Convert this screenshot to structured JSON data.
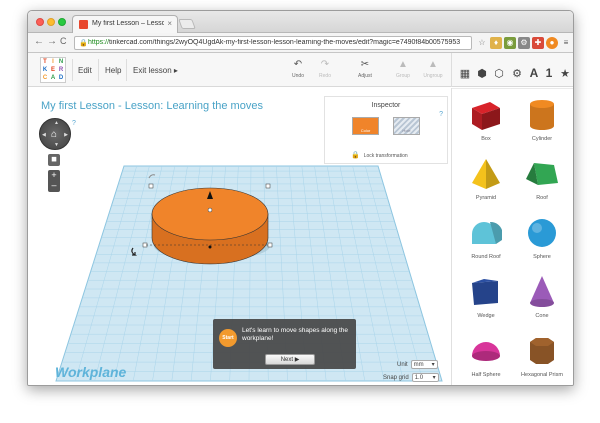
{
  "browser": {
    "tab_title": "My first Lesson – Lesson",
    "tab_close": "×",
    "url_scheme": "https://",
    "url_rest": "tinkercad.com/things/2wyOQ4UgdAk-my-first-lesson-lesson-learning-the-moves/edit?magic=e7490f84b00575953",
    "back": "←",
    "forward": "→",
    "reload": "C",
    "ext_icons": [
      "☆",
      "♦",
      "◉",
      "⚙",
      "✚",
      "●",
      "≡"
    ]
  },
  "logo": {
    "letters": [
      "T",
      "I",
      "N",
      "K",
      "E",
      "R",
      "C",
      "A",
      "D"
    ],
    "colors": [
      "#e2401c",
      "#f29a2e",
      "#2f9d4c",
      "#1d6fc5",
      "#e2401c",
      "#8d4fb1",
      "#f29a2e",
      "#2f9d4c",
      "#1d6fc5"
    ]
  },
  "menu": {
    "edit": "Edit",
    "help": "Help",
    "exit": "Exit lesson ▸"
  },
  "toolbar": {
    "undo": {
      "icon": "↶",
      "label": "Undo"
    },
    "redo": {
      "icon": "↷",
      "label": "Redo"
    },
    "adjust": {
      "icon": "✂",
      "label": "Adjust"
    },
    "group": {
      "icon": "▲",
      "label": "Group"
    },
    "ungroup": {
      "icon": "▲",
      "label": "Ungroup"
    }
  },
  "panel_icons": [
    "▦",
    "⬢",
    "⬡",
    "⚙",
    "A",
    "1",
    "★"
  ],
  "viewport": {
    "lesson_title": "My first Lesson - Lesson: Learning the moves",
    "help": "?",
    "nav_home": "⌂",
    "zoom_fit": "◼",
    "zoom_in": "+",
    "zoom_out": "–",
    "workplane": "Workplane",
    "unit_label": "Unit",
    "unit_value": "mm",
    "snap_label": "Snap grid",
    "snap_value": "1.0"
  },
  "inspector": {
    "title": "Inspector",
    "help": "?",
    "color_label": "Color",
    "hole_label": "Hole",
    "lock_icon": "🔒",
    "lock_label": "Lock transformation",
    "shape_color": "#f0842a"
  },
  "lesson_tip": {
    "start": "Start",
    "text": "Let's learn to move shapes along the workplane!",
    "next": "Next ▶"
  },
  "shapes": [
    {
      "name": "Box",
      "color": "#d8232a",
      "kind": "box"
    },
    {
      "name": "Cylinder",
      "color": "#f08a22",
      "kind": "cylinder"
    },
    {
      "name": "Pyramid",
      "color": "#f4c21c",
      "kind": "pyramid"
    },
    {
      "name": "Roof",
      "color": "#32a653",
      "kind": "roof"
    },
    {
      "name": "Round Roof",
      "color": "#5ec3d8",
      "kind": "roundroof"
    },
    {
      "name": "Sphere",
      "color": "#2a9ad6",
      "kind": "sphere"
    },
    {
      "name": "Wedge",
      "color": "#2b4fa2",
      "kind": "wedge"
    },
    {
      "name": "Cone",
      "color": "#9b5bb8",
      "kind": "cone"
    },
    {
      "name": "Half Sphere",
      "color": "#d8359a",
      "kind": "halfsphere"
    },
    {
      "name": "Hexagonal Prism",
      "color": "#a0622d",
      "kind": "hexprism"
    }
  ]
}
